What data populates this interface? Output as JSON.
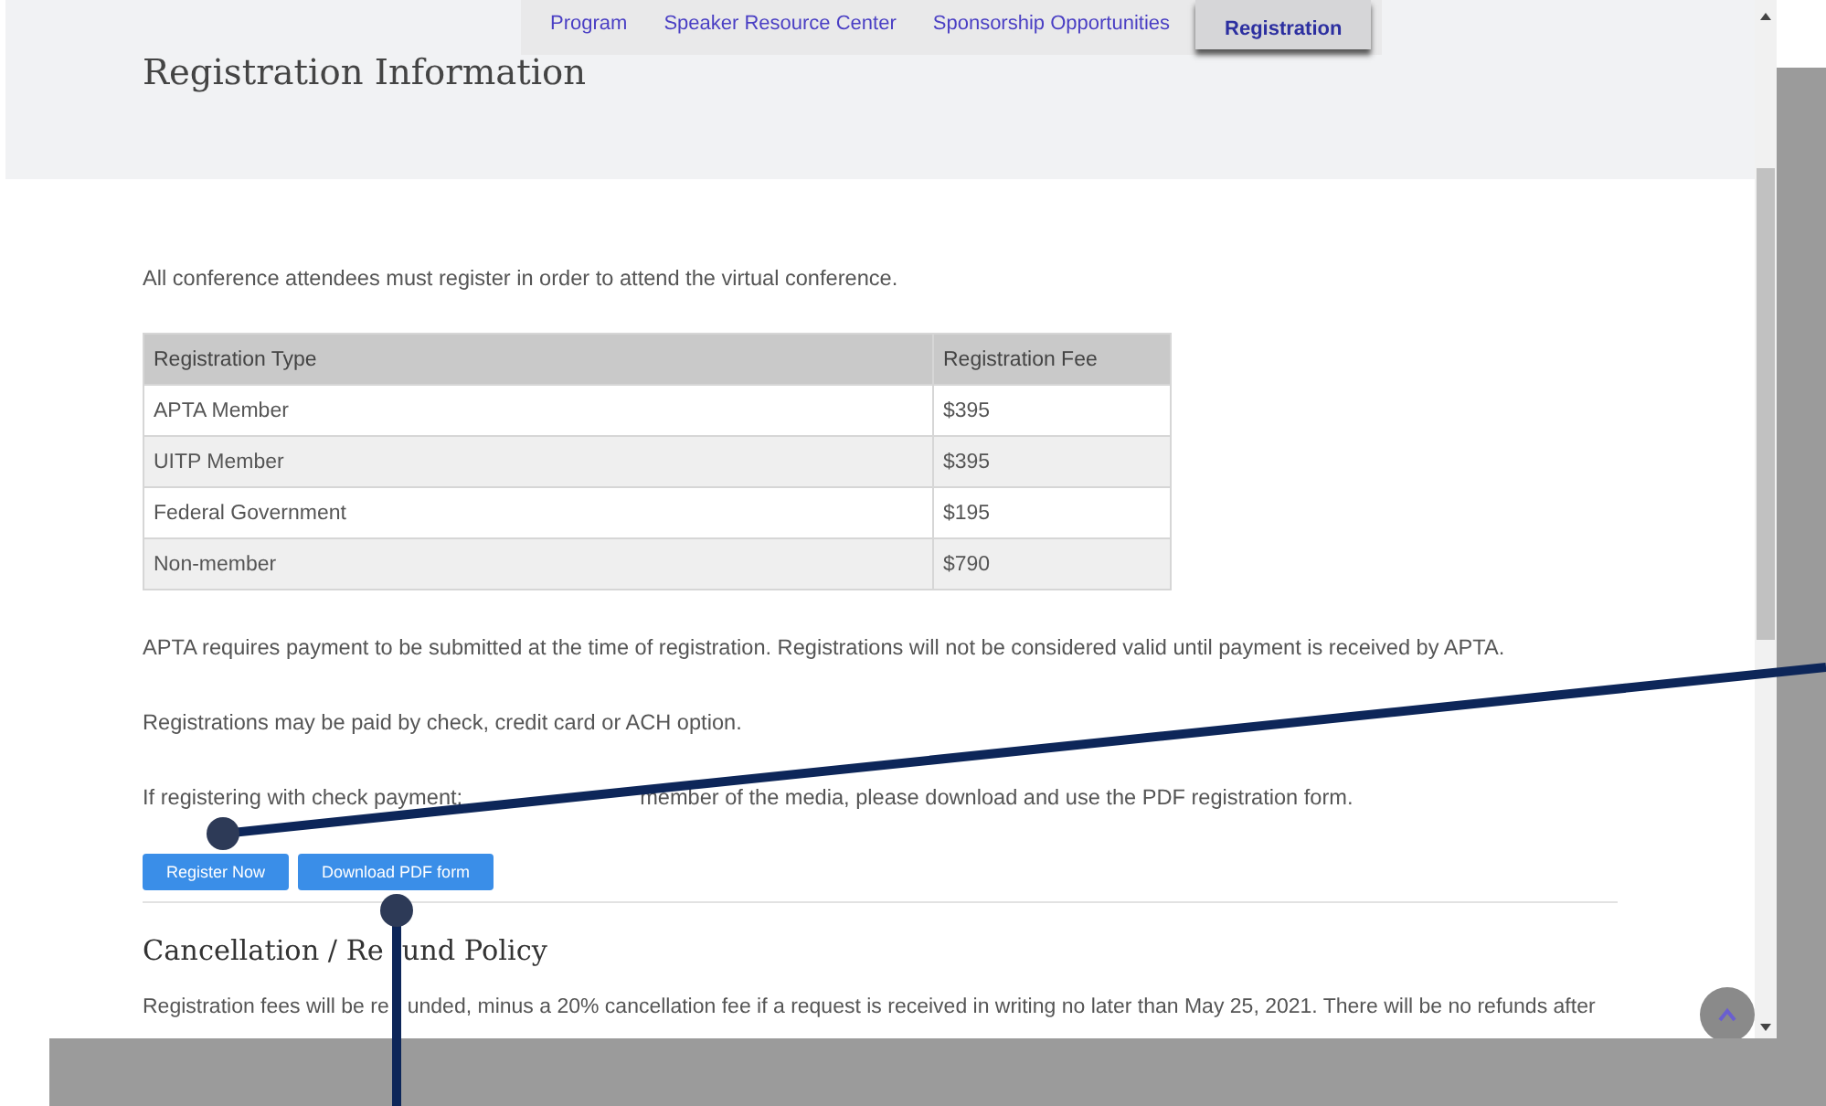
{
  "nav": {
    "tabs": [
      {
        "label": "Program",
        "selected": false
      },
      {
        "label": "Speaker Resource Center",
        "selected": false
      },
      {
        "label": "Sponsorship Opportunities",
        "selected": false
      },
      {
        "label": "Registration",
        "selected": true
      }
    ]
  },
  "header": {
    "title": "Registration Information"
  },
  "intro": "All conference attendees must register in order to attend the virtual conference.",
  "table": {
    "columns": [
      "Registration Type",
      "Registration Fee"
    ],
    "rows": [
      [
        "APTA Member",
        "$395"
      ],
      [
        "UITP Member",
        "$395"
      ],
      [
        "Federal Government",
        "$195"
      ],
      [
        "Non-member",
        "$790"
      ]
    ]
  },
  "paragraphs": [
    "APTA requires payment to be submitted at the time of registration. Registrations will not be considered valid until payment is received by APTA.",
    "Registrations may be paid by check, credit card or ACH option."
  ],
  "check_note": {
    "parts": [
      "If registering with check payment;",
      "member of the media, please download and use the PDF registration form."
    ]
  },
  "buttons": [
    "Register Now",
    "Download PDF form"
  ],
  "section": {
    "heading_parts": [
      "Cancellation / Re",
      "und Policy"
    ],
    "text_parts": [
      "Registration fees will be re",
      "unded, minus a 20% cancellation fee if a request is received in writing no later than May 25, 2021. There will be no refunds after"
    ]
  }
}
